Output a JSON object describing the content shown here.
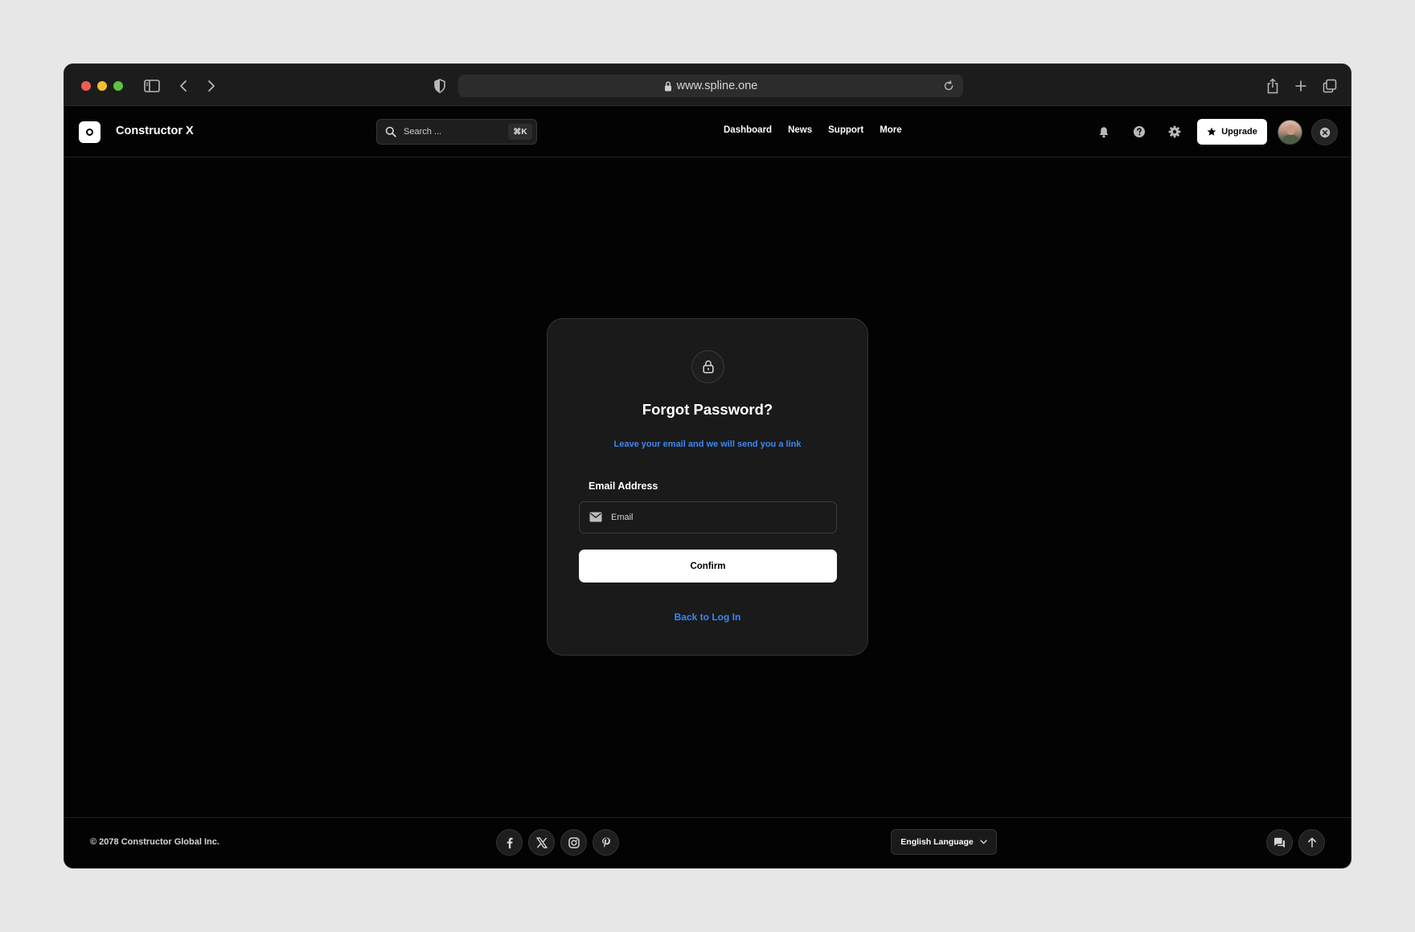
{
  "browser": {
    "url": "www.spline.one",
    "icons": [
      "sidebar-icon",
      "back-arrow-icon",
      "forward-arrow-icon",
      "shield-icon",
      "lock-icon",
      "reload-icon",
      "share-icon",
      "new-tab-icon",
      "tabs-icon"
    ]
  },
  "header": {
    "brand": "Constructor X",
    "search_placeholder": "Search ...",
    "search_shortcut": "⌘K",
    "nav": [
      "Dashboard",
      "News",
      "Support",
      "More"
    ],
    "upgrade_label": "Upgrade",
    "icons": [
      "bell-icon",
      "help-icon",
      "gear-icon",
      "star-icon",
      "close-icon"
    ]
  },
  "card": {
    "title": "Forgot Password?",
    "subtitle": "Leave your email and we will send you a link",
    "email_label": "Email Address",
    "email_placeholder": "Email",
    "email_value": "",
    "confirm_label": "Confirm",
    "back_link": "Back to Log In"
  },
  "footer": {
    "copyright": "© 2078 Constructor Global Inc.",
    "social": [
      "facebook-icon",
      "x-icon",
      "instagram-icon",
      "pinterest-icon"
    ],
    "language": "English Language"
  },
  "colors": {
    "accent": "#3d86f0",
    "background": "#030303",
    "card": "#1a1a1a"
  }
}
